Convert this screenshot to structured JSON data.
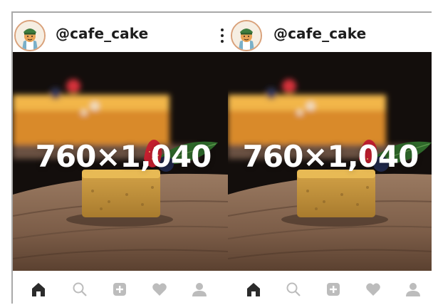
{
  "posts": [
    {
      "username": "@cafe_cake",
      "image_dimensions": "760×1,040",
      "nav": [
        "home-icon",
        "search-icon",
        "add-post-icon",
        "heart-icon",
        "profile-icon"
      ]
    },
    {
      "username": "@cafe_cake",
      "image_dimensions": "760×1,040",
      "nav": [
        "home-icon",
        "search-icon",
        "add-post-icon",
        "heart-icon",
        "profile-icon"
      ]
    }
  ],
  "colors": {
    "text": "#1d1d1d",
    "nav_active": "#2b2b2b",
    "nav_inactive": "#bcbcbc",
    "frame_border": "#a9a9a9"
  }
}
